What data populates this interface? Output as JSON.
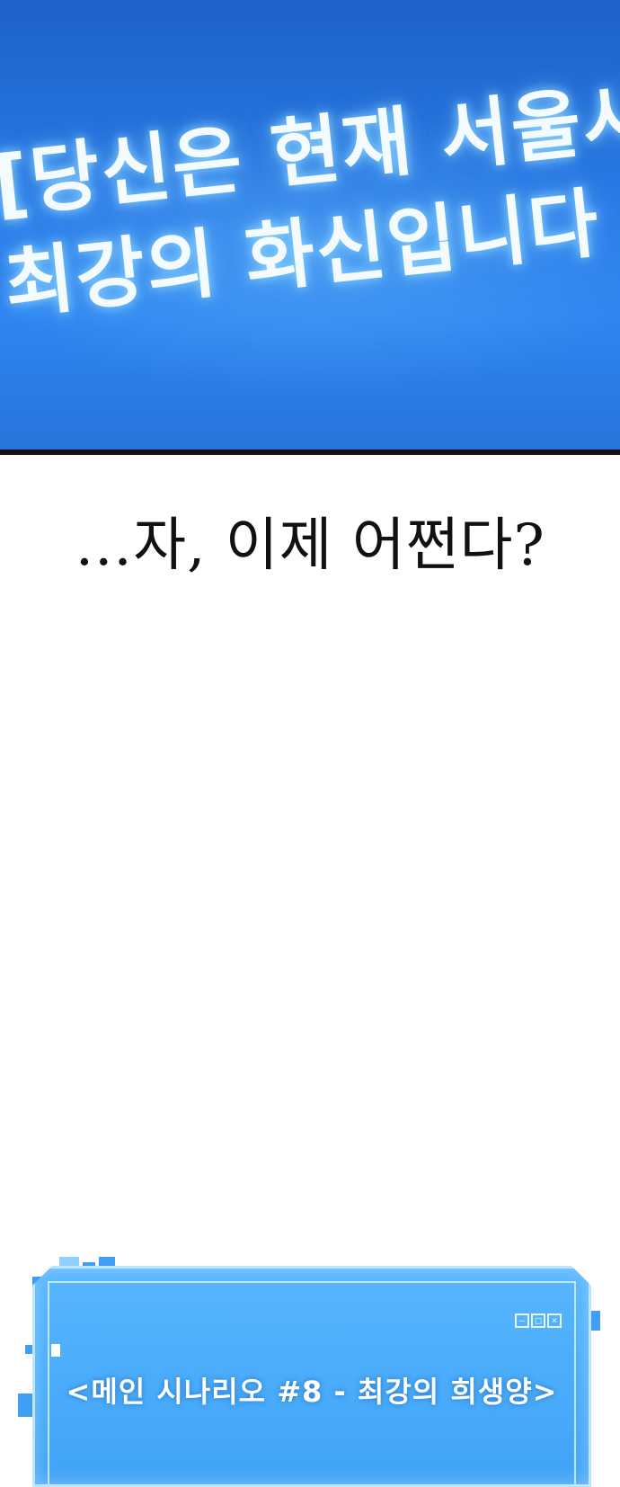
{
  "top_panel": {
    "banner_lines": [
      "[당신은 현재 서울시",
      "최강의 화신입니다"
    ]
  },
  "narration": "…자, 이제 어쩐다?",
  "scenario_window": {
    "title": "<메인 시나리오 #8 - 최강의 희생양>",
    "controls": {
      "minimize": "–",
      "maximize": "□",
      "close": "×"
    }
  },
  "colors": {
    "panel_blue": "#2a7ae6",
    "window_blue": "#57b6ff",
    "window_border": "#bfe6ff"
  }
}
